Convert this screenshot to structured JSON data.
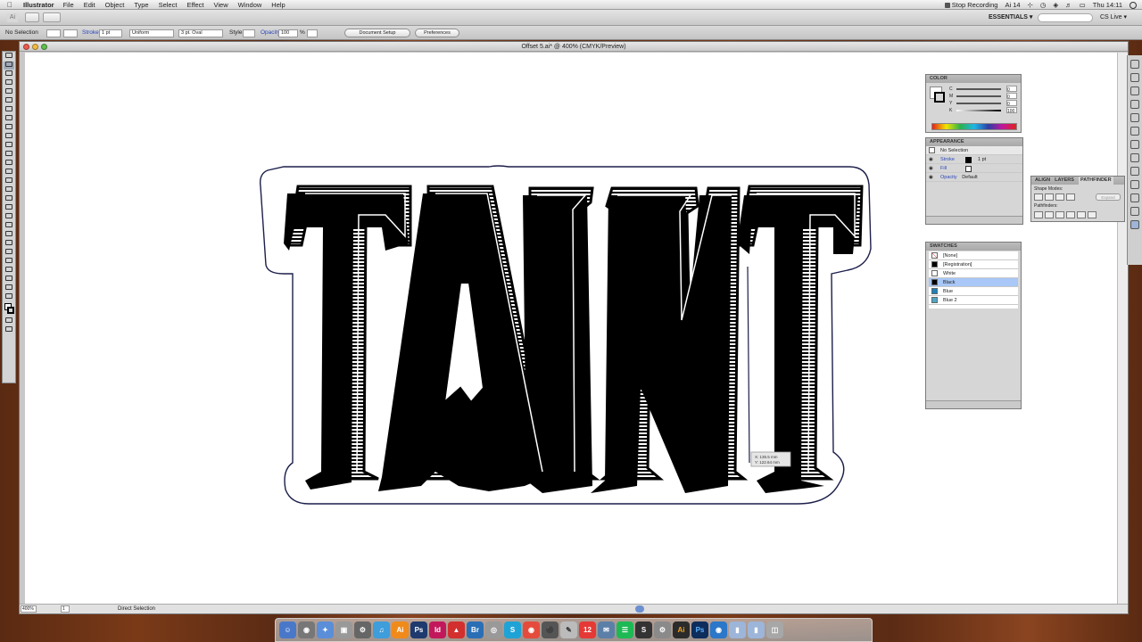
{
  "menubar": {
    "app_name": "Illustrator",
    "items": [
      "File",
      "Edit",
      "Object",
      "Type",
      "Select",
      "Effect",
      "View",
      "Window",
      "Help"
    ],
    "recording_label": "Stop Recording",
    "ai_badge": "14",
    "clock": "Thu 14:11"
  },
  "appbar": {
    "ai_mini": "Ai",
    "workspace": "ESSENTIALS ▾",
    "search_placeholder": "",
    "cs_live": "CS Live ▾"
  },
  "controlbar": {
    "selection_status": "No Selection",
    "stroke_label": "Stroke",
    "stroke_weight": "1 pt",
    "profile": "Uniform",
    "brush": "3 pt. Oval",
    "style_label": "Style",
    "opacity_label": "Opacity",
    "opacity_value": "100",
    "opacity_unit": "%",
    "document_setup": "Document Setup",
    "preferences": "Preferences"
  },
  "document": {
    "title": "Offset 5.ai* @ 400% (CMYK/Preview)",
    "zoom": "400%",
    "page": "1",
    "status": "Direct Selection",
    "artwork_text": "TAINT",
    "cursor_tooltip": [
      "X: 135.5 mm",
      "Y: 122.64 mm"
    ]
  },
  "color_panel": {
    "title": "COLOR",
    "channels": [
      {
        "label": "C",
        "value": "0"
      },
      {
        "label": "M",
        "value": "0"
      },
      {
        "label": "Y",
        "value": "0"
      },
      {
        "label": "K",
        "value": "100"
      }
    ]
  },
  "appearance_panel": {
    "title": "APPEARANCE",
    "header": "No Selection",
    "rows": [
      {
        "label": "Stroke",
        "value": "1 pt"
      },
      {
        "label": "Fill",
        "value": ""
      },
      {
        "label": "Opacity",
        "value": "Default"
      }
    ]
  },
  "align_panel": {
    "tabs": [
      "ALIGN",
      "LAYERS",
      "PATHFINDER"
    ],
    "shape_modes_label": "Shape Modes:",
    "pathfinders_label": "Pathfinders:",
    "expand_label": "Expand"
  },
  "swatches_panel": {
    "title": "SWATCHES",
    "items": [
      {
        "name": "[None]",
        "color": "#ffffff"
      },
      {
        "name": "[Registration]",
        "color": "#000000"
      },
      {
        "name": "White",
        "color": "#ffffff"
      },
      {
        "name": "Black",
        "color": "#000000"
      },
      {
        "name": "Blue",
        "color": "#1f7fb8"
      },
      {
        "name": "Blue 2",
        "color": "#4fa6c9"
      }
    ],
    "selected": "Black"
  },
  "colors": {
    "menubar_bg": "#e6e6e6",
    "canvas": "#ffffff",
    "ink": "#000000",
    "outline": "#1c1f4a",
    "highlight": "#a9c7f7"
  }
}
